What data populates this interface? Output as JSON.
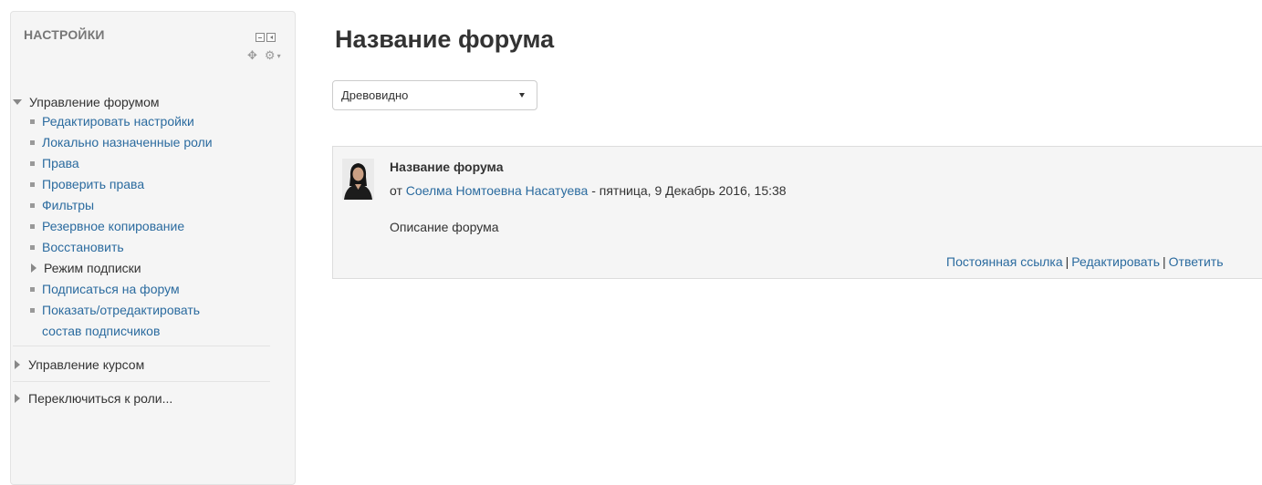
{
  "settings_block": {
    "title": "НАСТРОЙКИ",
    "forum_admin": {
      "label": "Управление форумом",
      "items": [
        "Редактировать настройки",
        "Локально назначенные роли",
        "Права",
        "Проверить права",
        "Фильтры",
        "Резервное копирование",
        "Восстановить",
        "Режим подписки",
        "Подписаться на форум",
        "Показать/отредактировать состав подписчиков"
      ]
    },
    "course_admin_label": "Управление курсом",
    "switch_role_label": "Переключиться к роли..."
  },
  "main": {
    "title": "Название форума",
    "display_mode": {
      "selected": "Древовидно"
    },
    "post": {
      "subject": "Название форума",
      "by_prefix": "от",
      "author": "Соелма Номтоевна Насатуева",
      "date": "- пятница, 9 Декабрь 2016, 15:38",
      "message": "Описание форума",
      "commands": [
        "Постоянная ссылка",
        "Редактировать",
        "Ответить"
      ]
    }
  },
  "colors": {
    "link": "#2b6b9f",
    "block_bg": "#f5f5f5",
    "text": "#333333"
  }
}
